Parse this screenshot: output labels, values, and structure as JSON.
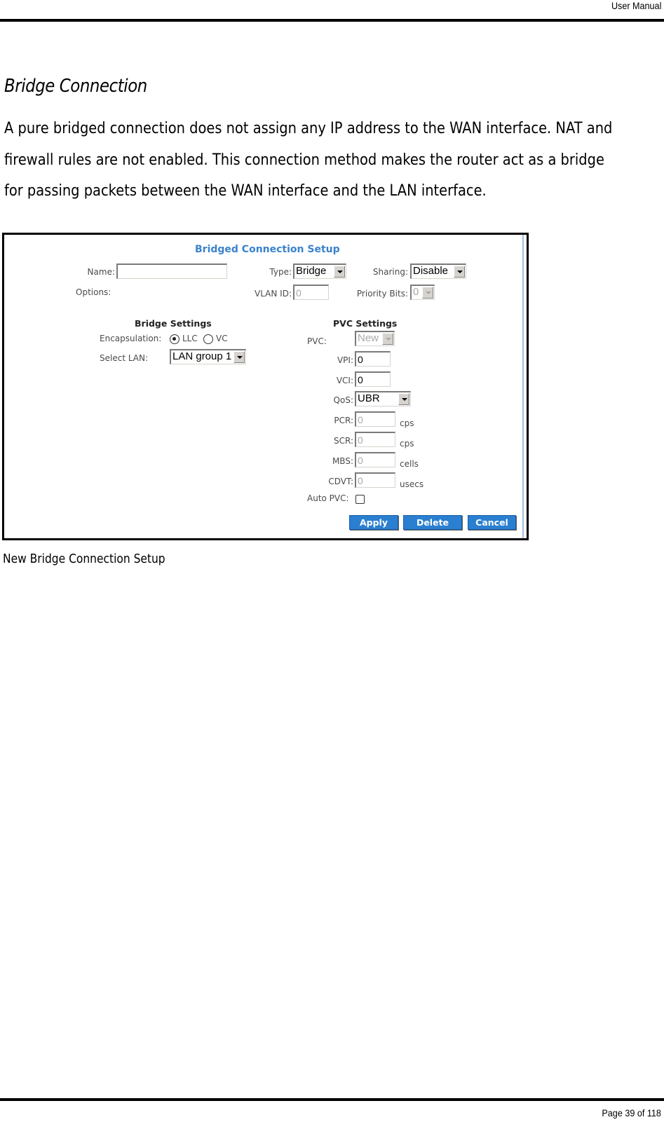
{
  "header": {
    "title": "User Manual"
  },
  "section": {
    "title": "Bridge Connection",
    "paragraph_lines": [
      "A pure bridged connection does not assign any IP address to the WAN interface. NAT and",
      "firewall rules are not enabled. This connection method makes the router act as a bridge",
      "for passing packets between the WAN interface and the LAN interface."
    ]
  },
  "form": {
    "title": "Bridged Connection Setup",
    "name": {
      "label": "Name:",
      "value": ""
    },
    "options_label": "Options:",
    "type": {
      "label": "Type:",
      "value": "Bridge"
    },
    "sharing": {
      "label": "Sharing:",
      "value": "Disable"
    },
    "vlan_id": {
      "label": "VLAN ID:",
      "value": "0"
    },
    "priority_bits": {
      "label": "Priority Bits:",
      "value": "0"
    },
    "bridge_settings": {
      "heading": "Bridge Settings",
      "encapsulation": {
        "label": "Encapsulation:",
        "options": [
          {
            "label": "LLC",
            "checked": true
          },
          {
            "label": "VC",
            "checked": false
          }
        ]
      },
      "select_lan": {
        "label": "Select LAN:",
        "value": "LAN group 1"
      }
    },
    "pvc_settings": {
      "heading": "PVC Settings",
      "pvc": {
        "label": "PVC:",
        "value": "New"
      },
      "vpi": {
        "label": "VPI:",
        "value": "0"
      },
      "vci": {
        "label": "VCI:",
        "value": "0"
      },
      "qos": {
        "label": "QoS:",
        "value": "UBR"
      },
      "pcr": {
        "label": "PCR:",
        "value": "0",
        "unit": "cps"
      },
      "scr": {
        "label": "SCR:",
        "value": "0",
        "unit": "cps"
      },
      "mbs": {
        "label": "MBS:",
        "value": "0",
        "unit": "cells"
      },
      "cdvt": {
        "label": "CDVT:",
        "value": "0",
        "unit": "usecs"
      },
      "auto_pvc": {
        "label": "Auto PVC:",
        "checked": false
      }
    },
    "buttons": {
      "apply": "Apply",
      "delete": "Delete",
      "cancel": "Cancel"
    }
  },
  "caption": "New Bridge Connection Setup",
  "footer": {
    "page_label": "Page 39  of 118"
  }
}
